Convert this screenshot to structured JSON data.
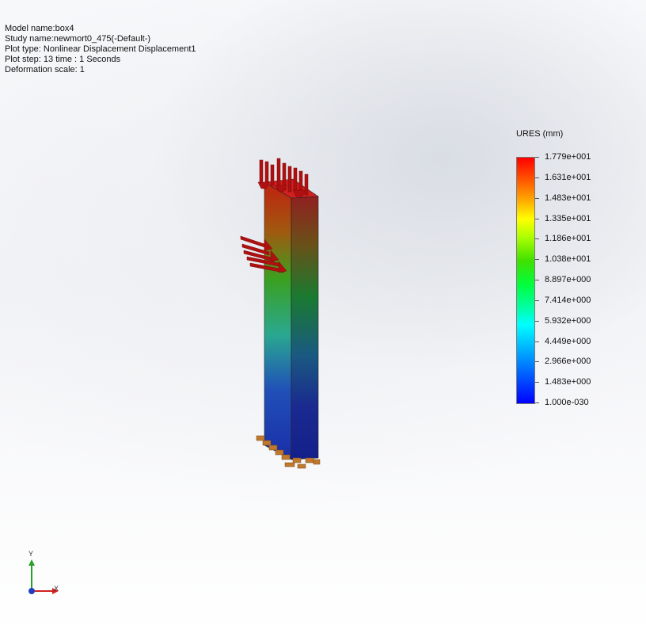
{
  "info": {
    "model_name": "Model name:box4",
    "study_name": "Study name:newmort0_475(-Default-)",
    "plot_type": "Plot type: Nonlinear Displacement Displacement1",
    "plot_step": "Plot step: 13   time : 1 Seconds",
    "deformation_scale": "Deformation scale: 1"
  },
  "legend": {
    "title": "URES (mm)",
    "labels": [
      "1.779e+001",
      "1.631e+001",
      "1.483e+001",
      "1.335e+001",
      "1.186e+001",
      "1.038e+001",
      "8.897e+000",
      "7.414e+000",
      "5.932e+000",
      "4.449e+000",
      "2.966e+000",
      "1.483e+000",
      "1.000e-030"
    ]
  },
  "triad": {
    "y_label": "Y",
    "x_label": "X"
  },
  "colors": {
    "load_arrow": "#b01010",
    "fixture": "#c0782c",
    "max_displacement": "#ff0000",
    "min_displacement": "#0000ff"
  }
}
